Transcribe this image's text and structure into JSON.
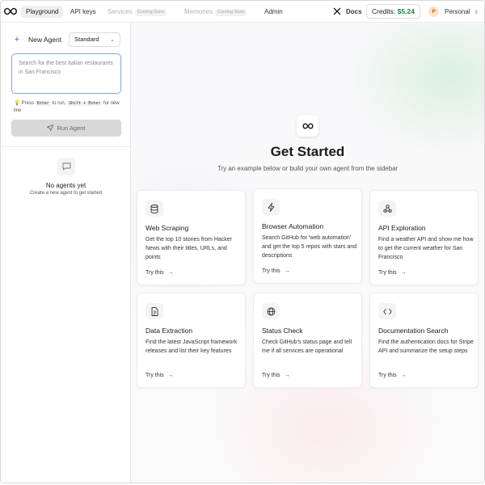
{
  "nav": {
    "items": [
      {
        "label": "Playground",
        "active": true
      },
      {
        "label": "API keys"
      },
      {
        "label": "Services",
        "badge": "Coming Soon",
        "disabled": true
      },
      {
        "label": "Memories",
        "badge": "Coming Soon",
        "disabled": true
      },
      {
        "label": "Admin"
      }
    ],
    "docs_label": "Docs",
    "credits_label": "Credits:",
    "credits_value": "$5.24",
    "avatar_initial": "P",
    "workspace": "Personal"
  },
  "sidebar": {
    "new_agent_label": "New Agent",
    "mode_value": "Standard",
    "prompt_placeholder": "Search for the best Italian restaurants in San Francisco",
    "hint": {
      "pre": "Press",
      "run_key": "Enter",
      "mid": "to run,",
      "newline_key": "Shift + Enter",
      "post": "for new line"
    },
    "run_label": "Run Agent",
    "empty_title": "No agents yet",
    "empty_subtitle": "Create a new agent to get started"
  },
  "main": {
    "title": "Get Started",
    "subtitle": "Try an example below or build your own agent from the sidebar",
    "cards": [
      {
        "title": "Web Scraping",
        "desc": "Get the top 10 stories from Hacker News with their titles, URLs, and points",
        "try": "Try this",
        "icon": "database-icon"
      },
      {
        "title": "Browser Automation",
        "desc": "Search GitHub for 'web automation' and get the top 5 repos with stars and descriptions",
        "try": "Try this",
        "icon": "lightning-icon"
      },
      {
        "title": "API Exploration",
        "desc": "Find a weather API and show me how to get the current weather for San Francisco",
        "try": "Try this",
        "icon": "webhook-icon"
      },
      {
        "title": "Data Extraction",
        "desc": "Find the latest JavaScript framework releases and list their key features",
        "try": "Try this",
        "icon": "document-icon"
      },
      {
        "title": "Status Check",
        "desc": "Check GitHub's status page and tell me if all services are operational",
        "try": "Try this",
        "icon": "globe-icon"
      },
      {
        "title": "Documentation Search",
        "desc": "Find the authentication docs for Stripe API and summarize the setup steps",
        "try": "Try this",
        "icon": "code-icon"
      }
    ]
  },
  "colors": {
    "accent": "#2b6fd6",
    "credits": "#1a8a3a"
  }
}
